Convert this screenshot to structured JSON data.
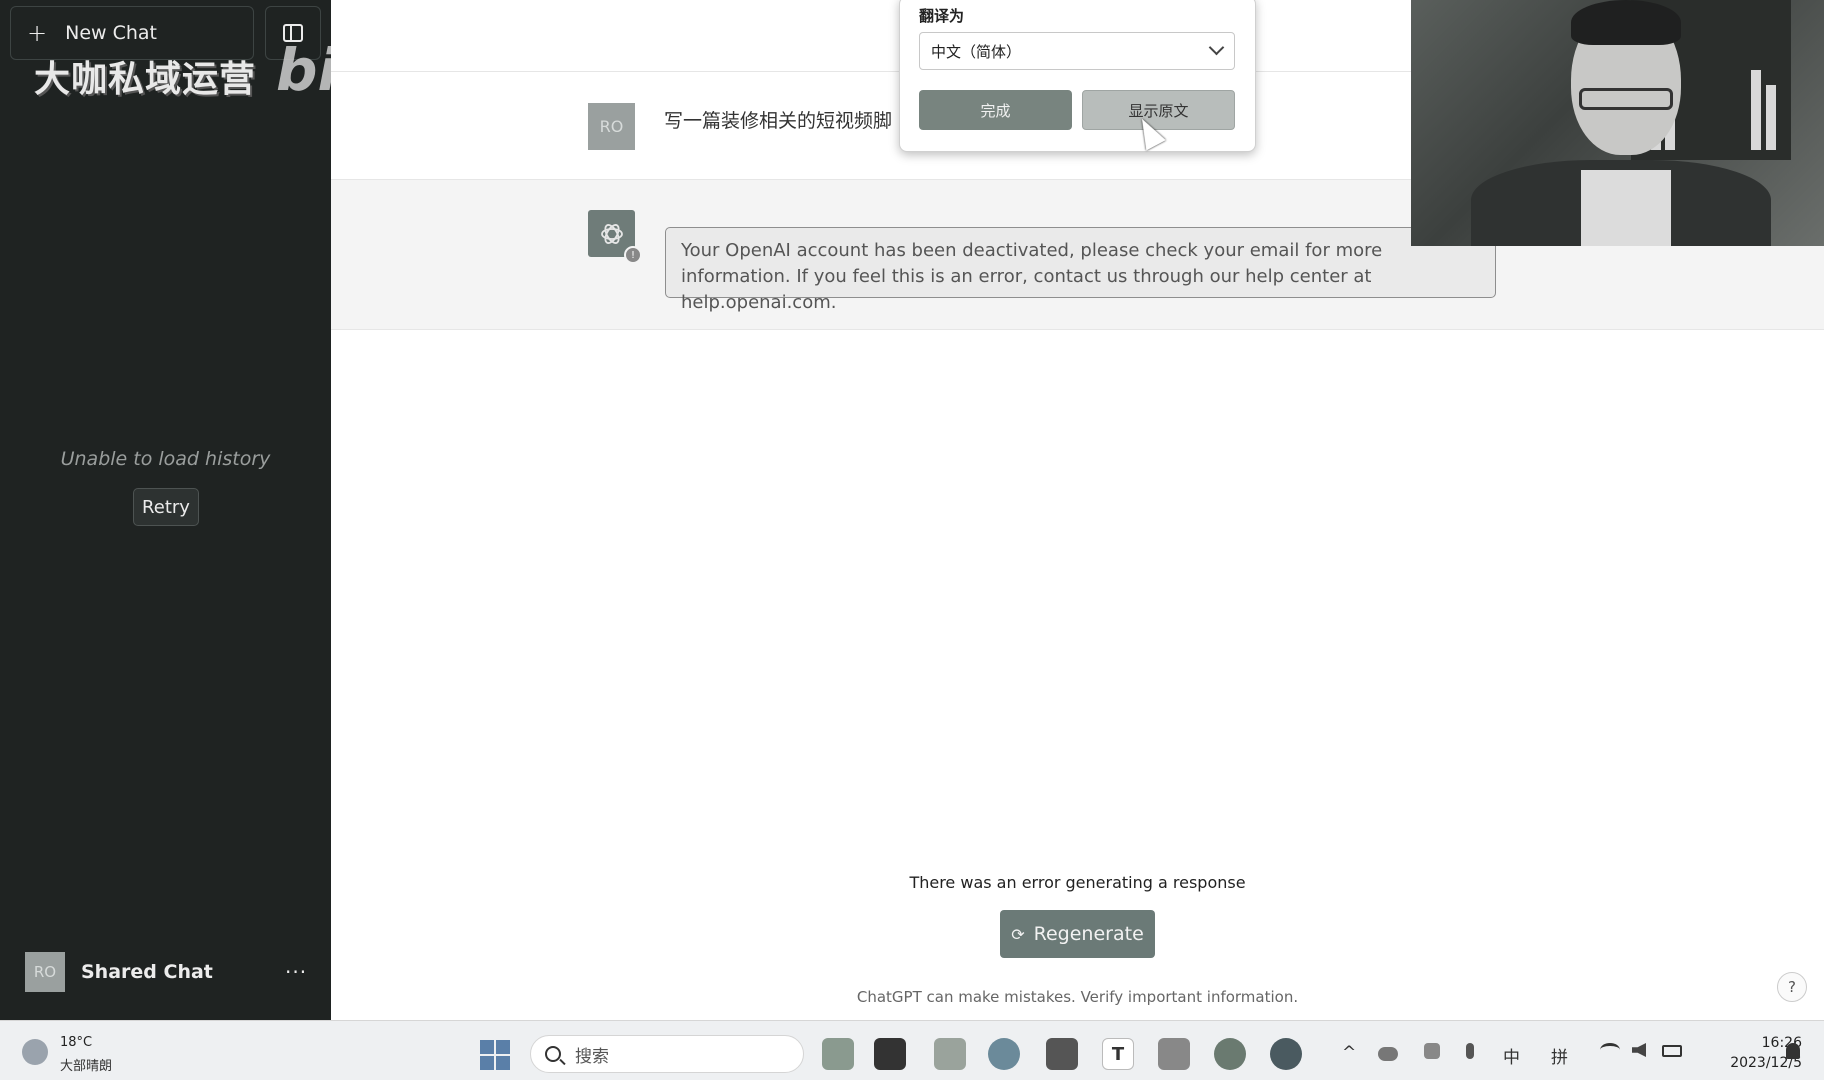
{
  "sidebar": {
    "new_chat_label": "New Chat",
    "watermark_text": "大咖私域运营",
    "watermark_logo": "bilibili",
    "history_error": "Unable to load history",
    "retry_label": "Retry",
    "user_avatar": "RO",
    "user_name": "Shared Chat",
    "more_label": "···"
  },
  "conversation": {
    "user_avatar": "RO",
    "user_message": "写一篇装修相关的短视频脚",
    "error_message": "Your OpenAI account has been deactivated, please check your email for more information. If you feel this is an error, contact us through our help center at help.openai.com.",
    "status_text": "There was an error generating a response",
    "regenerate_label": "Regenerate",
    "disclaimer": "ChatGPT can make mistakes. Verify important information.",
    "help_label": "?"
  },
  "translate_popup": {
    "label": "翻译为",
    "selected_language": "中文（简体）",
    "done_label": "完成",
    "show_original_label": "显示原文"
  },
  "taskbar": {
    "temperature": "18°C",
    "weather": "大部晴朗",
    "search_placeholder": "搜索",
    "app_t_label": "T",
    "ime_zh": "中",
    "ime_pinyin": "拼",
    "time": "16:26",
    "date": "2023/12/5"
  },
  "colors": {
    "sidebar_bg": "#1f2322",
    "accent": "#6b7a77",
    "error_border": "#8e8e8e"
  }
}
